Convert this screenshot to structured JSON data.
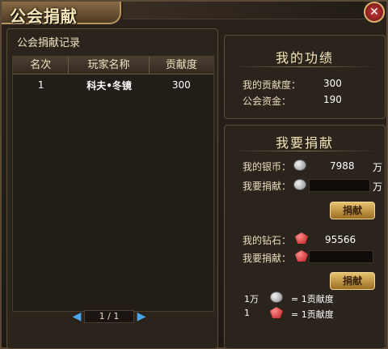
{
  "window": {
    "title": "公会捐献",
    "close_glyph": "✕"
  },
  "records": {
    "title": "公会捐献记录",
    "columns": [
      "名次",
      "玩家名称",
      "贡献度"
    ],
    "rows": [
      {
        "rank": "1",
        "name": "科夫•冬镜",
        "score": "300"
      }
    ],
    "pager": {
      "text": "1 / 1"
    }
  },
  "merit": {
    "title": "我的功绩",
    "contribution_label": "我的贡献度：",
    "contribution_value": "300",
    "fund_label": "公会资金：",
    "fund_value": "190"
  },
  "donate": {
    "title": "我要捐献",
    "silver_label": "我的银币：",
    "silver_value": "7988",
    "silver_unit": "万",
    "silver_input_label": "我要捐献：",
    "silver_input_unit": "万",
    "silver_button": "捐献",
    "diamond_label": "我的钻石：",
    "diamond_value": "95566",
    "diamond_input_label": "我要捐献：",
    "diamond_button": "捐献",
    "rate1_qty": "1万",
    "rate1_text": "= 1贡献度",
    "rate2_qty": "1",
    "rate2_text": "= 1贡献度"
  },
  "icons": {
    "silver": "silver-coin-icon",
    "diamond": "red-diamond-icon"
  },
  "colors": {
    "accent_gold": "#e6c26e",
    "panel": "#2b241d",
    "pager_arrow": "#4aa6e8"
  }
}
